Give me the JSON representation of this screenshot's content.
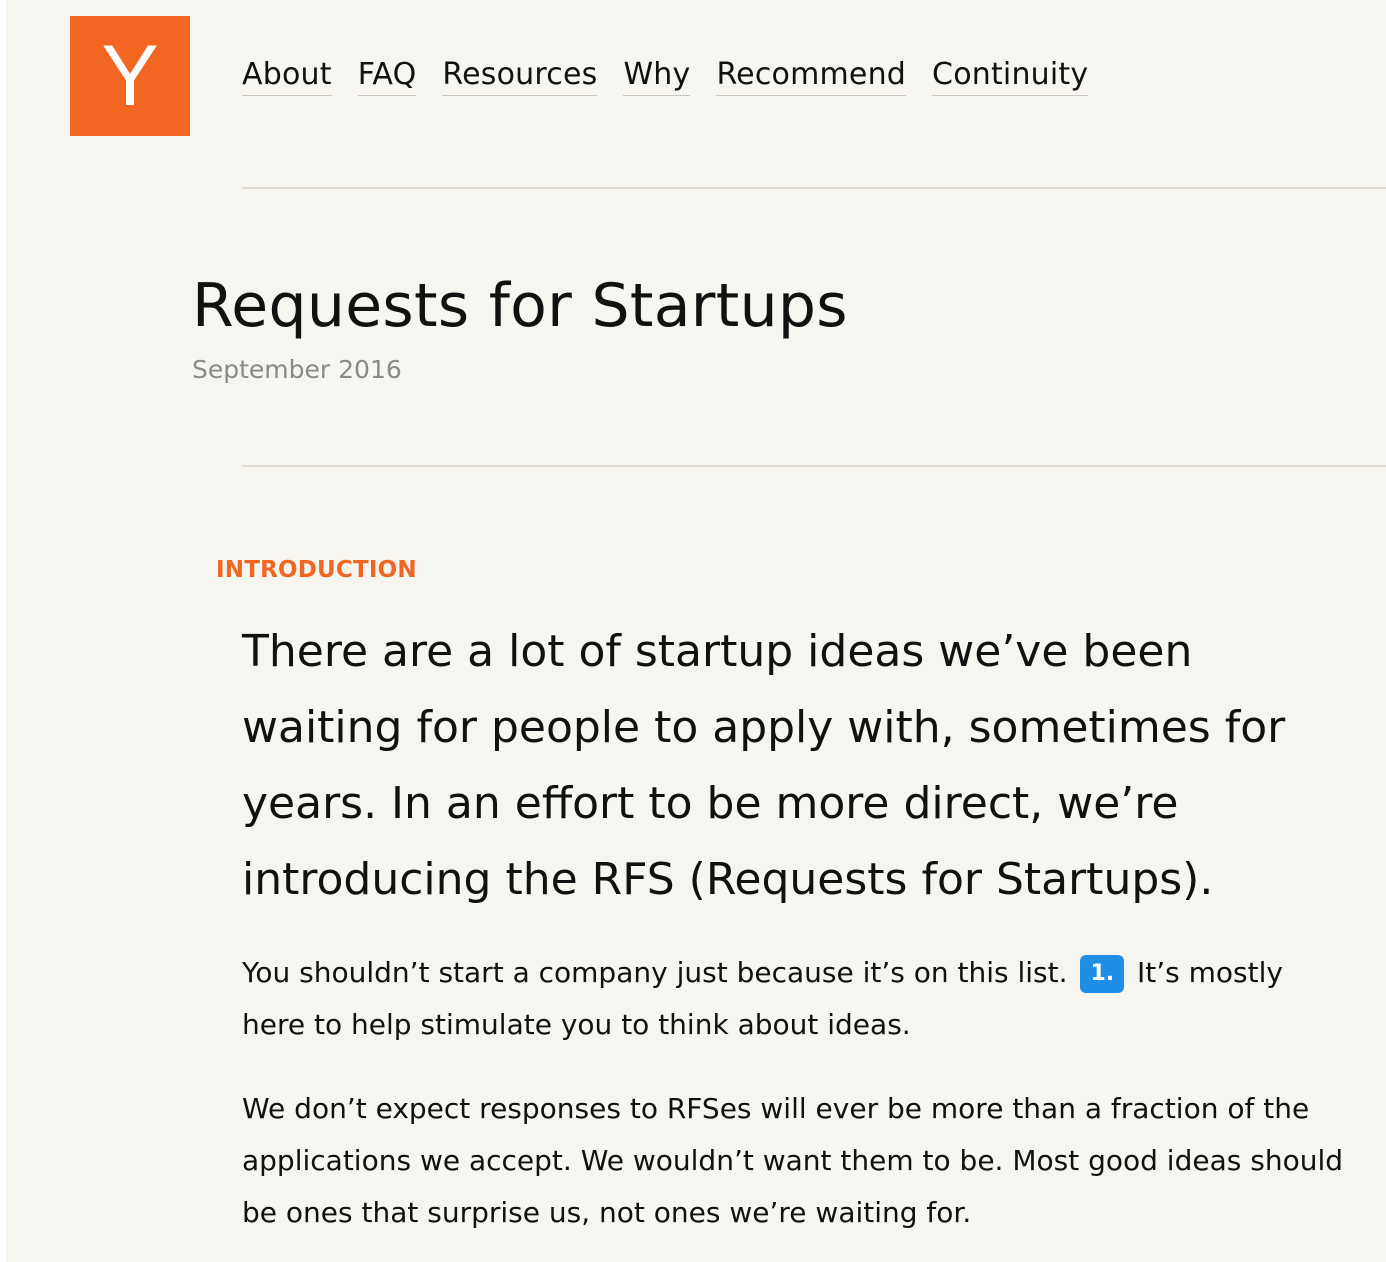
{
  "logo": {
    "letter": "Y"
  },
  "nav": {
    "items": [
      {
        "label": "About"
      },
      {
        "label": "FAQ"
      },
      {
        "label": "Resources"
      },
      {
        "label": "Why"
      },
      {
        "label": "Recommend"
      },
      {
        "label": "Continuity"
      }
    ]
  },
  "header": {
    "title": "Requests for Startups",
    "date": "September 2016"
  },
  "section": {
    "label": "INTRODUCTION",
    "lead": "There are a lot of startup ideas we’ve been waiting for people to apply with, sometimes for years. In an effort to be more direct, we’re introducing the RFS (Requests for Startups).",
    "p1_before": "You shouldn’t start a company just because it’s on this list.",
    "footnote_label": "1.",
    "p1_after": "It’s mostly here to help stimulate you to think about ideas.",
    "p2": "We don’t expect responses to RFSes will ever be more than a fraction of the applications we accept. We wouldn’t want them to be. Most good ideas should be ones that surprise us, not ones we’re waiting for."
  },
  "colors": {
    "brand_orange": "#f26622",
    "footnote_blue": "#1f8ee6",
    "background": "#f6f5ef"
  }
}
